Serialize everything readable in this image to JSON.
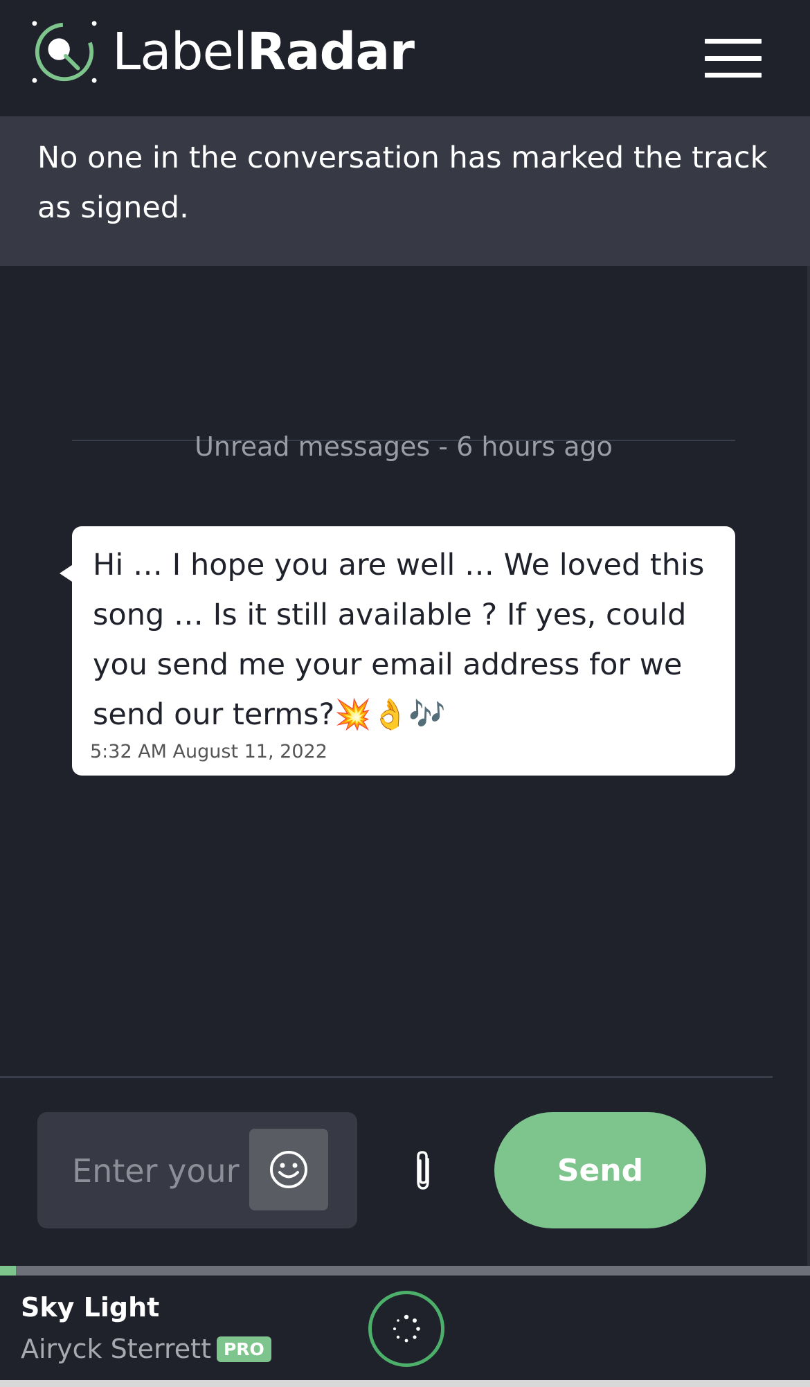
{
  "header": {
    "logo_light": "Label",
    "logo_bold": "Radar",
    "menu_icon": "hamburger-menu-icon"
  },
  "notice": {
    "text": "No one in the conversation has marked the track as signed."
  },
  "conversation": {
    "unread_divider": "Unread messages - 6 hours ago",
    "messages": [
      {
        "text": "Hi … I hope you are well … We loved this song … Is it still available ? If yes, could you send me your email address for we send our terms?💥👌🎶",
        "timestamp": "5:32 AM August 11, 2022"
      }
    ]
  },
  "composer": {
    "placeholder": "Enter your message",
    "emoji_icon": "smiley-icon",
    "attach_icon": "paperclip-icon",
    "send_label": "Send"
  },
  "player": {
    "track_title": "Sky Light",
    "artist": "Airyck Sterrett",
    "badge": "PRO",
    "progress_fraction": 0.02,
    "play_icon": "loading-spinner-icon"
  },
  "colors": {
    "background": "#1f212b",
    "notice_bg": "#373a45",
    "accent_green": "#7dc48d"
  }
}
